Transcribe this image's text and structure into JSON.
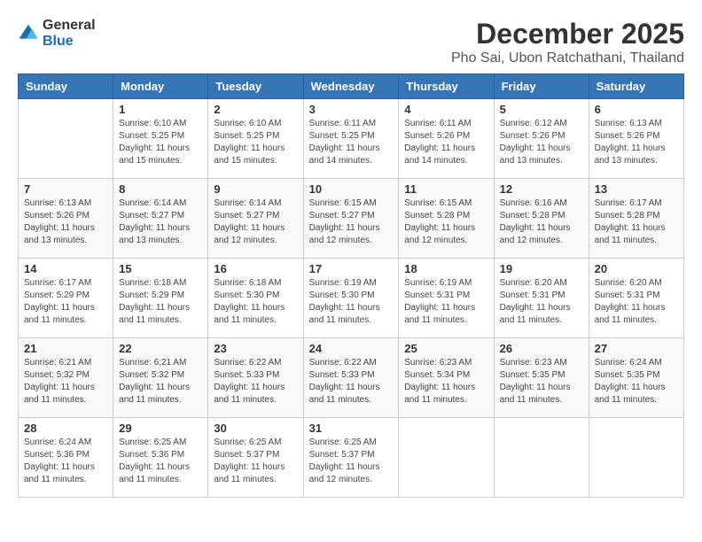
{
  "logo": {
    "general": "General",
    "blue": "Blue"
  },
  "title": "December 2025",
  "location": "Pho Sai, Ubon Ratchathani, Thailand",
  "days_header": [
    "Sunday",
    "Monday",
    "Tuesday",
    "Wednesday",
    "Thursday",
    "Friday",
    "Saturday"
  ],
  "weeks": [
    [
      {
        "day": "",
        "sunrise": "",
        "sunset": "",
        "daylight": ""
      },
      {
        "day": "1",
        "sunrise": "Sunrise: 6:10 AM",
        "sunset": "Sunset: 5:25 PM",
        "daylight": "Daylight: 11 hours and 15 minutes."
      },
      {
        "day": "2",
        "sunrise": "Sunrise: 6:10 AM",
        "sunset": "Sunset: 5:25 PM",
        "daylight": "Daylight: 11 hours and 15 minutes."
      },
      {
        "day": "3",
        "sunrise": "Sunrise: 6:11 AM",
        "sunset": "Sunset: 5:25 PM",
        "daylight": "Daylight: 11 hours and 14 minutes."
      },
      {
        "day": "4",
        "sunrise": "Sunrise: 6:11 AM",
        "sunset": "Sunset: 5:26 PM",
        "daylight": "Daylight: 11 hours and 14 minutes."
      },
      {
        "day": "5",
        "sunrise": "Sunrise: 6:12 AM",
        "sunset": "Sunset: 5:26 PM",
        "daylight": "Daylight: 11 hours and 13 minutes."
      },
      {
        "day": "6",
        "sunrise": "Sunrise: 6:13 AM",
        "sunset": "Sunset: 5:26 PM",
        "daylight": "Daylight: 11 hours and 13 minutes."
      }
    ],
    [
      {
        "day": "7",
        "sunrise": "Sunrise: 6:13 AM",
        "sunset": "Sunset: 5:26 PM",
        "daylight": "Daylight: 11 hours and 13 minutes."
      },
      {
        "day": "8",
        "sunrise": "Sunrise: 6:14 AM",
        "sunset": "Sunset: 5:27 PM",
        "daylight": "Daylight: 11 hours and 13 minutes."
      },
      {
        "day": "9",
        "sunrise": "Sunrise: 6:14 AM",
        "sunset": "Sunset: 5:27 PM",
        "daylight": "Daylight: 11 hours and 12 minutes."
      },
      {
        "day": "10",
        "sunrise": "Sunrise: 6:15 AM",
        "sunset": "Sunset: 5:27 PM",
        "daylight": "Daylight: 11 hours and 12 minutes."
      },
      {
        "day": "11",
        "sunrise": "Sunrise: 6:15 AM",
        "sunset": "Sunset: 5:28 PM",
        "daylight": "Daylight: 11 hours and 12 minutes."
      },
      {
        "day": "12",
        "sunrise": "Sunrise: 6:16 AM",
        "sunset": "Sunset: 5:28 PM",
        "daylight": "Daylight: 11 hours and 12 minutes."
      },
      {
        "day": "13",
        "sunrise": "Sunrise: 6:17 AM",
        "sunset": "Sunset: 5:28 PM",
        "daylight": "Daylight: 11 hours and 11 minutes."
      }
    ],
    [
      {
        "day": "14",
        "sunrise": "Sunrise: 6:17 AM",
        "sunset": "Sunset: 5:29 PM",
        "daylight": "Daylight: 11 hours and 11 minutes."
      },
      {
        "day": "15",
        "sunrise": "Sunrise: 6:18 AM",
        "sunset": "Sunset: 5:29 PM",
        "daylight": "Daylight: 11 hours and 11 minutes."
      },
      {
        "day": "16",
        "sunrise": "Sunrise: 6:18 AM",
        "sunset": "Sunset: 5:30 PM",
        "daylight": "Daylight: 11 hours and 11 minutes."
      },
      {
        "day": "17",
        "sunrise": "Sunrise: 6:19 AM",
        "sunset": "Sunset: 5:30 PM",
        "daylight": "Daylight: 11 hours and 11 minutes."
      },
      {
        "day": "18",
        "sunrise": "Sunrise: 6:19 AM",
        "sunset": "Sunset: 5:31 PM",
        "daylight": "Daylight: 11 hours and 11 minutes."
      },
      {
        "day": "19",
        "sunrise": "Sunrise: 6:20 AM",
        "sunset": "Sunset: 5:31 PM",
        "daylight": "Daylight: 11 hours and 11 minutes."
      },
      {
        "day": "20",
        "sunrise": "Sunrise: 6:20 AM",
        "sunset": "Sunset: 5:31 PM",
        "daylight": "Daylight: 11 hours and 11 minutes."
      }
    ],
    [
      {
        "day": "21",
        "sunrise": "Sunrise: 6:21 AM",
        "sunset": "Sunset: 5:32 PM",
        "daylight": "Daylight: 11 hours and 11 minutes."
      },
      {
        "day": "22",
        "sunrise": "Sunrise: 6:21 AM",
        "sunset": "Sunset: 5:32 PM",
        "daylight": "Daylight: 11 hours and 11 minutes."
      },
      {
        "day": "23",
        "sunrise": "Sunrise: 6:22 AM",
        "sunset": "Sunset: 5:33 PM",
        "daylight": "Daylight: 11 hours and 11 minutes."
      },
      {
        "day": "24",
        "sunrise": "Sunrise: 6:22 AM",
        "sunset": "Sunset: 5:33 PM",
        "daylight": "Daylight: 11 hours and 11 minutes."
      },
      {
        "day": "25",
        "sunrise": "Sunrise: 6:23 AM",
        "sunset": "Sunset: 5:34 PM",
        "daylight": "Daylight: 11 hours and 11 minutes."
      },
      {
        "day": "26",
        "sunrise": "Sunrise: 6:23 AM",
        "sunset": "Sunset: 5:35 PM",
        "daylight": "Daylight: 11 hours and 11 minutes."
      },
      {
        "day": "27",
        "sunrise": "Sunrise: 6:24 AM",
        "sunset": "Sunset: 5:35 PM",
        "daylight": "Daylight: 11 hours and 11 minutes."
      }
    ],
    [
      {
        "day": "28",
        "sunrise": "Sunrise: 6:24 AM",
        "sunset": "Sunset: 5:36 PM",
        "daylight": "Daylight: 11 hours and 11 minutes."
      },
      {
        "day": "29",
        "sunrise": "Sunrise: 6:25 AM",
        "sunset": "Sunset: 5:36 PM",
        "daylight": "Daylight: 11 hours and 11 minutes."
      },
      {
        "day": "30",
        "sunrise": "Sunrise: 6:25 AM",
        "sunset": "Sunset: 5:37 PM",
        "daylight": "Daylight: 11 hours and 11 minutes."
      },
      {
        "day": "31",
        "sunrise": "Sunrise: 6:25 AM",
        "sunset": "Sunset: 5:37 PM",
        "daylight": "Daylight: 11 hours and 12 minutes."
      },
      {
        "day": "",
        "sunrise": "",
        "sunset": "",
        "daylight": ""
      },
      {
        "day": "",
        "sunrise": "",
        "sunset": "",
        "daylight": ""
      },
      {
        "day": "",
        "sunrise": "",
        "sunset": "",
        "daylight": ""
      }
    ]
  ]
}
